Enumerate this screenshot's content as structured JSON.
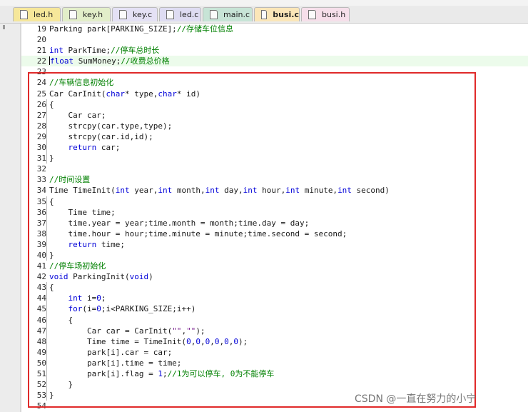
{
  "window": {
    "crumb": ""
  },
  "tabs": [
    {
      "label": "led.h",
      "color": "#f6e79a",
      "active": false
    },
    {
      "label": "key.h",
      "color": "#e2eec9",
      "active": false
    },
    {
      "label": "key.c",
      "color": "#e4e1f5",
      "active": false
    },
    {
      "label": "led.c",
      "color": "#dedcf2",
      "active": false
    },
    {
      "label": "main.c",
      "color": "#c7e4d6",
      "active": false
    },
    {
      "label": "busi.c",
      "color": "#fbe6b8",
      "active": true
    },
    {
      "label": "busi.h",
      "color": "#f6dfea",
      "active": false
    }
  ],
  "editor": {
    "lines": [
      {
        "n": "19",
        "fold": false,
        "hl": false,
        "tokens": [
          [
            "Parking park[PARKING_SIZE];",
            ""
          ],
          [
            "//存储车位信息",
            "cmt"
          ]
        ]
      },
      {
        "n": "20",
        "fold": false,
        "hl": false,
        "tokens": []
      },
      {
        "n": "21",
        "fold": false,
        "hl": false,
        "tokens": [
          [
            "int",
            "kw"
          ],
          [
            " ParkTime;",
            ""
          ],
          [
            "//停车总时长",
            "cmt"
          ]
        ]
      },
      {
        "n": "22",
        "fold": false,
        "hl": true,
        "caret": true,
        "tokens": [
          [
            "float",
            "kw"
          ],
          [
            " SumMoney;",
            ""
          ],
          [
            "//收费总价格",
            "cmt"
          ]
        ]
      },
      {
        "n": "23",
        "fold": false,
        "hl": false,
        "tokens": []
      },
      {
        "n": "24",
        "fold": false,
        "hl": false,
        "tokens": [
          [
            "//车辆信息初始化",
            "cmt"
          ]
        ]
      },
      {
        "n": "25",
        "fold": false,
        "hl": false,
        "tokens": [
          [
            "Car CarInit(",
            ""
          ],
          [
            "char",
            "kw"
          ],
          [
            "* type,",
            ""
          ],
          [
            "char",
            "kw"
          ],
          [
            "* id)",
            ""
          ]
        ]
      },
      {
        "n": "26",
        "fold": true,
        "hl": false,
        "tokens": [
          [
            "{",
            ""
          ]
        ]
      },
      {
        "n": "27",
        "fold": true,
        "hl": false,
        "tokens": [
          [
            "    Car car;",
            ""
          ]
        ]
      },
      {
        "n": "28",
        "fold": true,
        "hl": false,
        "tokens": [
          [
            "    strcpy(car.type,type);",
            ""
          ]
        ]
      },
      {
        "n": "29",
        "fold": true,
        "hl": false,
        "tokens": [
          [
            "    strcpy(car.id,id);",
            ""
          ]
        ]
      },
      {
        "n": "30",
        "fold": true,
        "hl": false,
        "tokens": [
          [
            "    ",
            ""
          ],
          [
            "return",
            "kw"
          ],
          [
            " car;",
            ""
          ]
        ]
      },
      {
        "n": "31",
        "fold": true,
        "hl": false,
        "tokens": [
          [
            "}",
            ""
          ]
        ]
      },
      {
        "n": "32",
        "fold": false,
        "hl": false,
        "tokens": []
      },
      {
        "n": "33",
        "fold": false,
        "hl": false,
        "tokens": [
          [
            "//时间设置",
            "cmt"
          ]
        ]
      },
      {
        "n": "34",
        "fold": false,
        "hl": false,
        "tokens": [
          [
            "Time TimeInit(",
            ""
          ],
          [
            "int",
            "kw"
          ],
          [
            " year,",
            ""
          ],
          [
            "int",
            "kw"
          ],
          [
            " month,",
            ""
          ],
          [
            "int",
            "kw"
          ],
          [
            " day,",
            ""
          ],
          [
            "int",
            "kw"
          ],
          [
            " hour,",
            ""
          ],
          [
            "int",
            "kw"
          ],
          [
            " minute,",
            ""
          ],
          [
            "int",
            "kw"
          ],
          [
            " second)",
            ""
          ]
        ]
      },
      {
        "n": "35",
        "fold": true,
        "hl": false,
        "tokens": [
          [
            "{",
            ""
          ]
        ]
      },
      {
        "n": "36",
        "fold": true,
        "hl": false,
        "tokens": [
          [
            "    Time time;",
            ""
          ]
        ]
      },
      {
        "n": "37",
        "fold": true,
        "hl": false,
        "tokens": [
          [
            "    time.year = year;time.month = month;time.day = day;",
            ""
          ]
        ]
      },
      {
        "n": "38",
        "fold": true,
        "hl": false,
        "tokens": [
          [
            "    time.hour = hour;time.minute = minute;time.second = second;",
            ""
          ]
        ]
      },
      {
        "n": "39",
        "fold": true,
        "hl": false,
        "tokens": [
          [
            "    ",
            ""
          ],
          [
            "return",
            "kw"
          ],
          [
            " time;",
            ""
          ]
        ]
      },
      {
        "n": "40",
        "fold": true,
        "hl": false,
        "tokens": [
          [
            "}",
            ""
          ]
        ]
      },
      {
        "n": "41",
        "fold": false,
        "hl": false,
        "tokens": [
          [
            "//停车场初始化",
            "cmt"
          ]
        ]
      },
      {
        "n": "42",
        "fold": false,
        "hl": false,
        "tokens": [
          [
            "void",
            "kw"
          ],
          [
            " ParkingInit(",
            ""
          ],
          [
            "void",
            "kw"
          ],
          [
            ")",
            ""
          ]
        ]
      },
      {
        "n": "43",
        "fold": true,
        "hl": false,
        "tokens": [
          [
            "{",
            ""
          ]
        ]
      },
      {
        "n": "44",
        "fold": true,
        "hl": false,
        "tokens": [
          [
            "    ",
            ""
          ],
          [
            "int",
            "kw"
          ],
          [
            " i=",
            ""
          ],
          [
            "0",
            "num"
          ],
          [
            ";",
            ""
          ]
        ]
      },
      {
        "n": "45",
        "fold": true,
        "hl": false,
        "tokens": [
          [
            "    ",
            ""
          ],
          [
            "for",
            "kw"
          ],
          [
            "(i=",
            ""
          ],
          [
            "0",
            "num"
          ],
          [
            ";i<PARKING_SIZE;i++)",
            ""
          ]
        ]
      },
      {
        "n": "46",
        "fold": true,
        "hl": false,
        "tokens": [
          [
            "    {",
            ""
          ]
        ]
      },
      {
        "n": "47",
        "fold": true,
        "hl": false,
        "tokens": [
          [
            "        Car car = CarInit(",
            ""
          ],
          [
            "\"\"",
            "str"
          ],
          [
            ",",
            ""
          ],
          [
            "\"\"",
            "str"
          ],
          [
            ");",
            ""
          ]
        ]
      },
      {
        "n": "48",
        "fold": true,
        "hl": false,
        "tokens": [
          [
            "        Time time = TimeInit(",
            ""
          ],
          [
            "0",
            "num"
          ],
          [
            ",",
            ""
          ],
          [
            "0",
            "num"
          ],
          [
            ",",
            ""
          ],
          [
            "0",
            "num"
          ],
          [
            ",",
            ""
          ],
          [
            "0",
            "num"
          ],
          [
            ",",
            ""
          ],
          [
            "0",
            "num"
          ],
          [
            ",",
            ""
          ],
          [
            "0",
            "num"
          ],
          [
            ");",
            ""
          ]
        ]
      },
      {
        "n": "49",
        "fold": true,
        "hl": false,
        "tokens": [
          [
            "        park[i].car = car;",
            ""
          ]
        ]
      },
      {
        "n": "50",
        "fold": true,
        "hl": false,
        "tokens": [
          [
            "        park[i].time = time;",
            ""
          ]
        ]
      },
      {
        "n": "51",
        "fold": true,
        "hl": false,
        "tokens": [
          [
            "        park[i].flag = ",
            ""
          ],
          [
            "1",
            "num"
          ],
          [
            ";",
            ""
          ],
          [
            "//1为可以停车, 0为不能停车",
            "cmt"
          ]
        ]
      },
      {
        "n": "52",
        "fold": true,
        "hl": false,
        "tokens": [
          [
            "    }",
            ""
          ]
        ]
      },
      {
        "n": "53",
        "fold": true,
        "hl": false,
        "tokens": [
          [
            "}",
            ""
          ]
        ]
      },
      {
        "n": "54",
        "fold": false,
        "hl": false,
        "tokens": []
      }
    ]
  },
  "watermark": "CSDN @一直在努力的小宁",
  "colors": {
    "keyword": "#0000d8",
    "comment": "#008000",
    "highlight": "#ecfbeb",
    "annotation_box": "#e02a2a"
  }
}
